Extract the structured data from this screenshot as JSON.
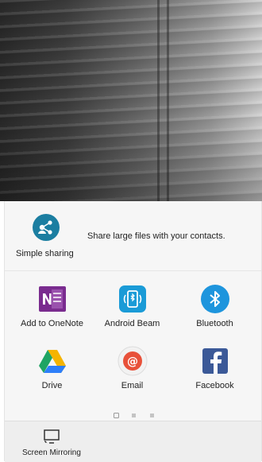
{
  "simple_sharing": {
    "label": "Simple sharing",
    "description": "Share large files with your contacts.",
    "icon": "simple-sharing-icon",
    "color": "#1b7ea1"
  },
  "apps": [
    {
      "label": "Add to OneNote",
      "icon": "onenote-icon",
      "color": "#7a2c8f"
    },
    {
      "label": "Android Beam",
      "icon": "android-beam-icon",
      "color": "#1a9bd7"
    },
    {
      "label": "Bluetooth",
      "icon": "bluetooth-icon",
      "color": "#1e95dd"
    },
    {
      "label": "Drive",
      "icon": "google-drive-icon",
      "color": "#1fa463"
    },
    {
      "label": "Email",
      "icon": "email-icon",
      "color": "#e8513a"
    },
    {
      "label": "Facebook",
      "icon": "facebook-icon",
      "color": "#3b5998"
    }
  ],
  "pager": {
    "pages": 3,
    "current": 1
  },
  "bottom_bar": {
    "screen_mirroring_label": "Screen Mirroring",
    "icon": "screen-mirroring-icon"
  }
}
